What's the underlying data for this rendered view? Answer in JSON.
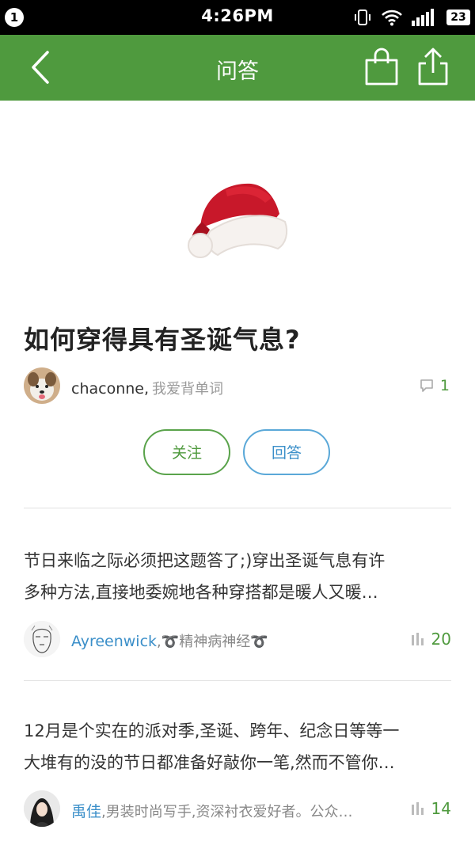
{
  "status_bar": {
    "notification_count": "1",
    "time": "4:26PM",
    "battery": "23",
    "icons": [
      "vibrate-icon",
      "wifi-icon",
      "signal-icon",
      "battery-icon"
    ]
  },
  "nav": {
    "title": "问答",
    "back_icon": "chevron-left-icon",
    "bag_icon": "shopping-bag-icon",
    "share_icon": "share-icon"
  },
  "question": {
    "title": "如何穿得具有圣诞气息?",
    "author_name": "chaconne",
    "author_separator": ",",
    "author_bio": "我爱背单词",
    "comment_count": "1"
  },
  "actions": {
    "follow_label": "关注",
    "answer_label": "回答"
  },
  "answers": [
    {
      "line1": "节日来临之际必须把这题答了;)穿出圣诞气息有许",
      "line2": "多种方法,直接地委婉地各种穿搭都是暖人又暖…",
      "author_name": "Ayreenwick",
      "author_separator": ",",
      "author_bio": "➰精神病神经➰",
      "votes": "20"
    },
    {
      "line1": "12月是个实在的派对季,圣诞、跨年、纪念日等等一",
      "line2": "大堆有的没的节日都准备好敲你一笔,然而不管你…",
      "author_name": "禹佳",
      "author_separator": ",",
      "author_bio": "男装时尚写手,资深衬衣爱好者。公众…",
      "votes": "14"
    }
  ],
  "colors": {
    "nav_green": "#4f9a3e",
    "link_blue": "#3b8fc9",
    "status_black": "#000000"
  }
}
